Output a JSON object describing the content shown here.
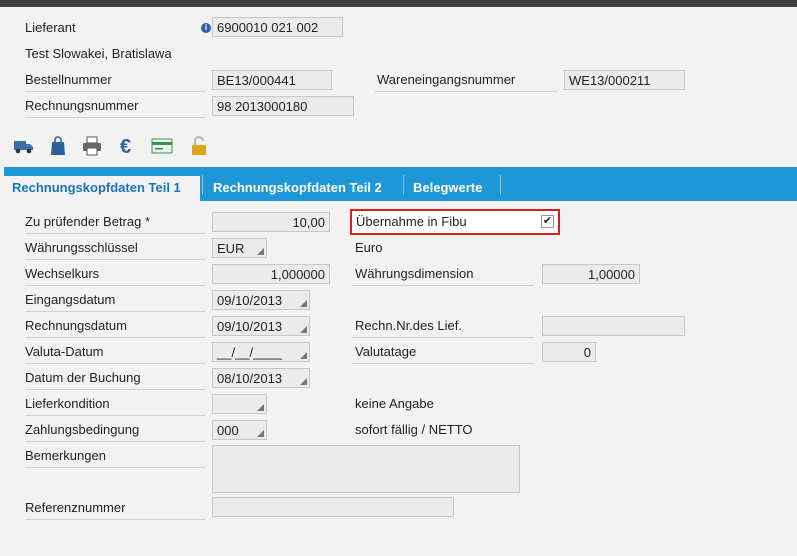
{
  "header": {
    "lieferant_label": "Lieferant",
    "lieferant_value": "6900010 021 002",
    "lieferant_name": "Test Slowakei,  Bratislawa",
    "bestellnummer_label": "Bestellnummer",
    "bestellnummer_value": "BE13/000441",
    "wareneingang_label": "Wareneingangsnummer",
    "wareneingang_value": "WE13/000211",
    "rechnungsnummer_label": "Rechnungsnummer",
    "rechnungsnummer_value": "98   2013000180"
  },
  "toolbar": {
    "icons": [
      "truck-icon",
      "shopping-bag-icon",
      "printer-icon",
      "euro-icon",
      "card-icon",
      "unlock-icon"
    ],
    "colors": {
      "truck": "#3a6fa8",
      "bag": "#2f5f9c",
      "printer": "#555555",
      "euro": "#2a62a6",
      "card": "#3b8f4c",
      "lock": "#e2a21a"
    }
  },
  "tabs": [
    {
      "label": "Rechnungskopfdaten Teil 1",
      "active": true
    },
    {
      "label": "Rechnungskopfdaten Teil 2",
      "active": false
    },
    {
      "label": "Belegwerte",
      "active": false
    }
  ],
  "form": {
    "betrag_label": "Zu prüfender Betrag *",
    "betrag_value": "10,00",
    "fibu_label": "Übernahme in Fibu",
    "fibu_checked": true,
    "fibu_check_glyph": "✔",
    "waehrung_label": "Währungsschlüssel",
    "waehrung_value": "EUR",
    "waehrung_text": "Euro",
    "wechselkurs_label": "Wechselkurs",
    "wechselkurs_value": "1,000000",
    "wdim_label": "Währungsdimension",
    "wdim_value": "1,00000",
    "eingang_label": "Eingangsdatum",
    "eingang_value": "09/10/2013",
    "rdatum_label": "Rechnungsdatum",
    "rdatum_value": "09/10/2013",
    "rnrlief_label": "Rechn.Nr.des Lief.",
    "rnrlief_value": "",
    "valuta_label": "Valuta-Datum",
    "valuta_value": "__/__/____",
    "valutatage_label": "Valutatage",
    "valutatage_value": "0",
    "buchung_label": "Datum der Buchung",
    "buchung_value": "08/10/2013",
    "lieferkondition_label": "Lieferkondition",
    "lieferkondition_value": "",
    "lieferkondition_text": "keine Angabe",
    "zahlung_label": "Zahlungsbedingung",
    "zahlung_value": "000",
    "zahlung_text": "sofort fällig /  NETTO",
    "bemerkungen_label": "Bemerkungen",
    "bemerkungen_value": "",
    "referenz_label": "Referenznummer",
    "referenz_value": ""
  }
}
